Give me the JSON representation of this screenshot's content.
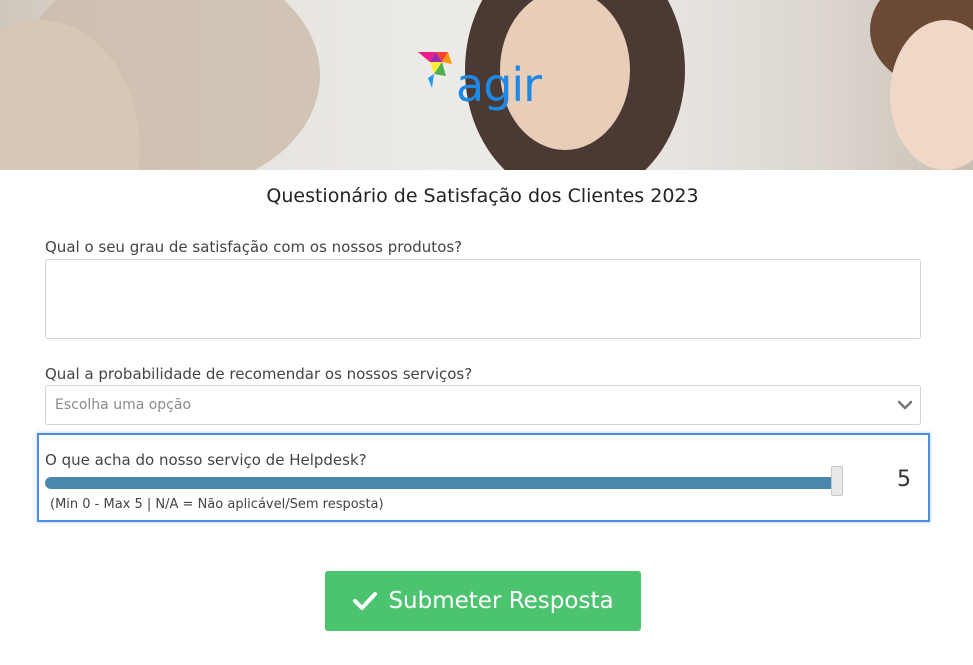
{
  "brand": {
    "logo_text": "agir"
  },
  "form": {
    "title": "Questionário de Satisfação dos Clientes 2023",
    "q1": {
      "label": "Qual o seu grau de satisfação com os nossos produtos?",
      "value": ""
    },
    "q2": {
      "label": "Qual a probabilidade de recomendar os nossos serviços?",
      "placeholder": "Escolha uma opção"
    },
    "q3": {
      "label": "O que acha do nosso serviço de Helpdesk?",
      "value": "5",
      "min": 0,
      "max": 5,
      "hint": "(Min 0 - Max 5 | N/A = Não aplicável/Sem resposta)"
    },
    "submit_label": "Submeter Resposta"
  },
  "colors": {
    "brand_blue": "#1e88e5",
    "slider_fill": "#4a86ad",
    "focus_border": "#4a90e2",
    "submit_bg": "#4cc46f"
  }
}
